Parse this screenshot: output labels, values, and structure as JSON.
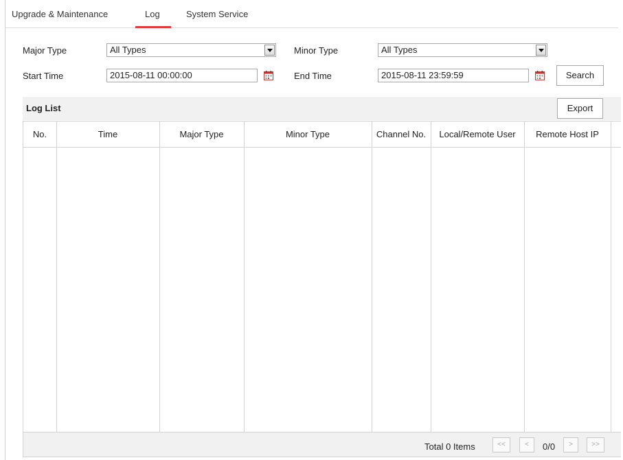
{
  "tabs": [
    {
      "label": "Upgrade & Maintenance"
    },
    {
      "label": "Log"
    },
    {
      "label": "System Service"
    }
  ],
  "filters": {
    "major_type_label": "Major Type",
    "major_type_value": "All Types",
    "minor_type_label": "Minor Type",
    "minor_type_value": "All Types",
    "start_time_label": "Start Time",
    "start_time_value": "2015-08-11 00:00:00",
    "end_time_label": "End Time",
    "end_time_value": "2015-08-11 23:59:59",
    "search_label": "Search"
  },
  "log_list": {
    "title": "Log List",
    "export_label": "Export",
    "columns": [
      "No.",
      "Time",
      "Major Type",
      "Minor Type",
      "Channel No.",
      "Local/Remote User",
      "Remote Host IP"
    ],
    "rows": []
  },
  "pagination": {
    "total_text": "Total 0 Items",
    "first": "<<",
    "prev": "<",
    "page_info": "0/0",
    "next": ">",
    "last": ">>"
  },
  "colors": {
    "active_tab_underline": "#e23a3a",
    "calendar_icon": "#c0392b"
  },
  "icons": [
    "dropdown-arrow-icon",
    "calendar-icon"
  ]
}
